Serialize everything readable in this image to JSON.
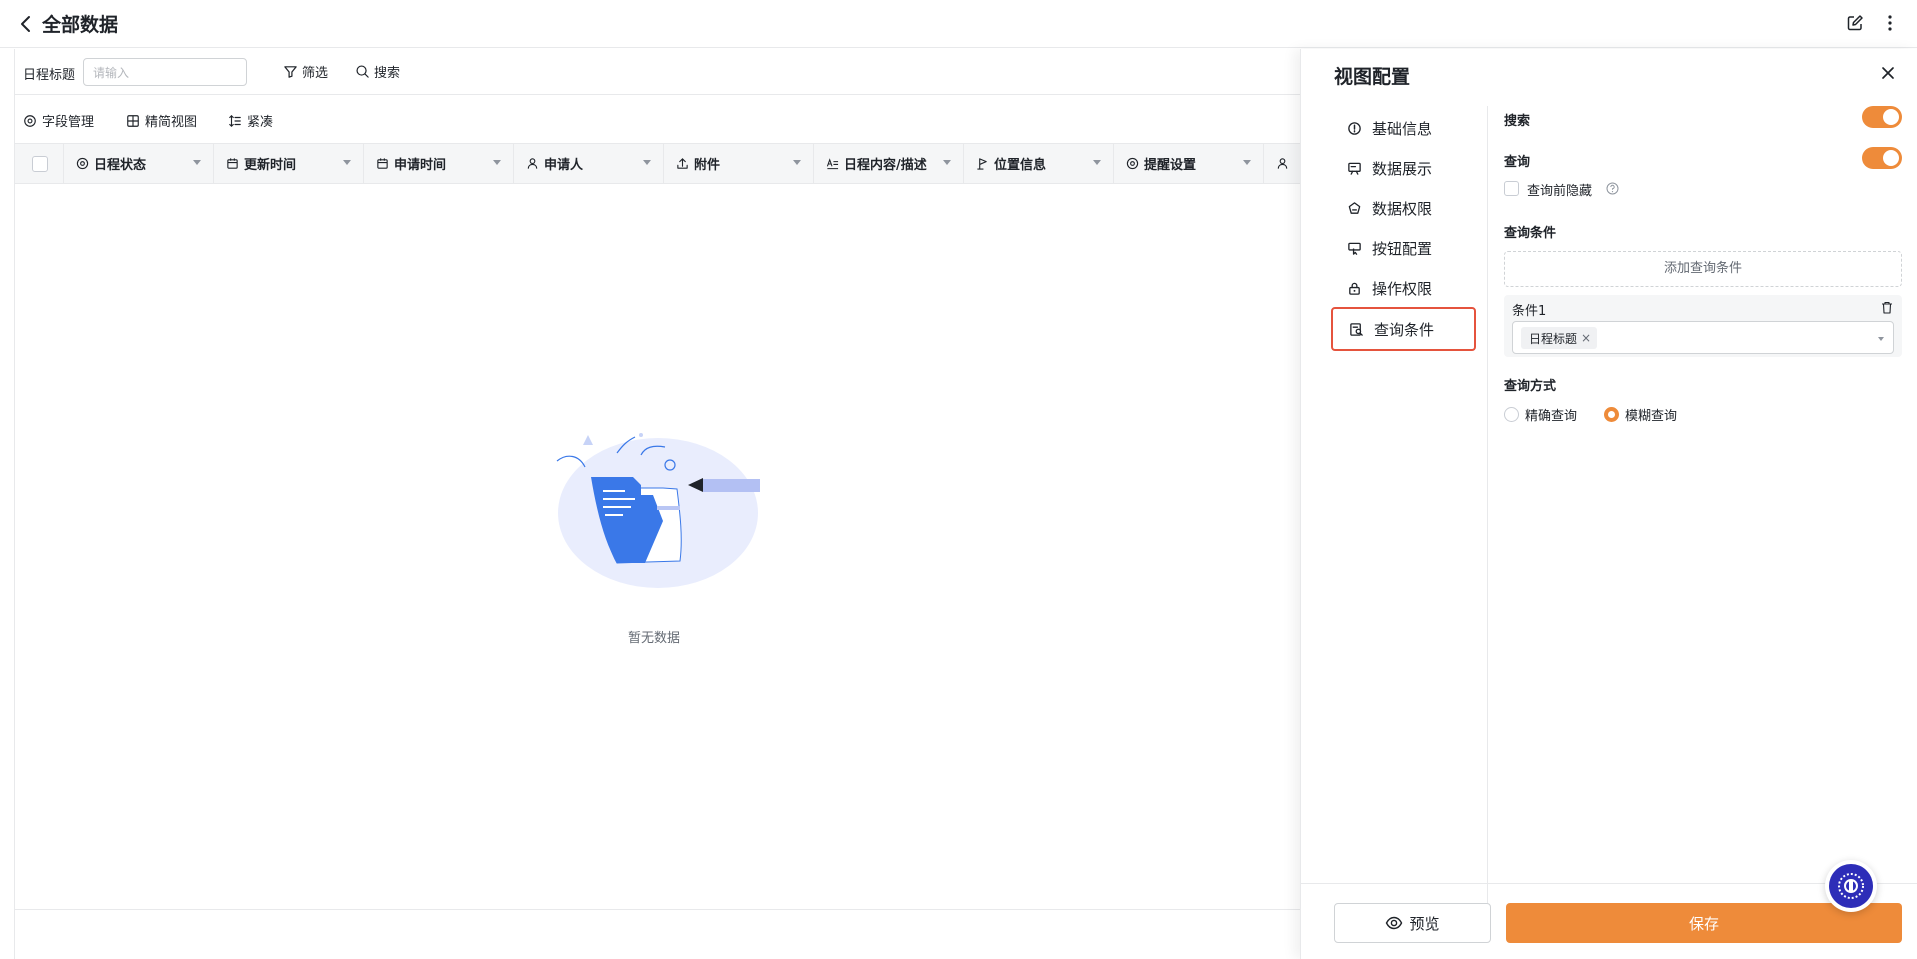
{
  "header": {
    "title": "全部数据"
  },
  "filter_bar": {
    "field_label": "日程标题",
    "input_placeholder": "请输入",
    "filter_label": "筛选",
    "search_label": "搜索"
  },
  "toolbar": {
    "field_manage": "字段管理",
    "compact_view": "精简视图",
    "density": "紧凑"
  },
  "table": {
    "columns": [
      {
        "label": "日程状态",
        "icon": "status-icon"
      },
      {
        "label": "更新时间",
        "icon": "calendar-icon"
      },
      {
        "label": "申请时间",
        "icon": "calendar-icon"
      },
      {
        "label": "申请人",
        "icon": "person-icon"
      },
      {
        "label": "附件",
        "icon": "upload-icon"
      },
      {
        "label": "日程内容/描述",
        "icon": "text-icon"
      },
      {
        "label": "位置信息",
        "icon": "location-icon"
      },
      {
        "label": "提醒设置",
        "icon": "status-icon"
      },
      {
        "label": "",
        "icon": "person-icon"
      }
    ],
    "empty_text": "暂无数据"
  },
  "panel": {
    "title": "视图配置",
    "nav": [
      {
        "label": "基础信息",
        "icon": "info-icon",
        "active": false
      },
      {
        "label": "数据展示",
        "icon": "display-icon",
        "active": false
      },
      {
        "label": "数据权限",
        "icon": "permission-icon",
        "active": false
      },
      {
        "label": "按钮配置",
        "icon": "button-config-icon",
        "active": false
      },
      {
        "label": "操作权限",
        "icon": "lock-icon",
        "active": false
      },
      {
        "label": "查询条件",
        "icon": "query-icon",
        "active": true
      }
    ],
    "search_label": "搜索",
    "search_enabled": true,
    "query_label": "查询",
    "query_enabled": true,
    "hide_before_query_label": "查询前隐藏",
    "hide_before_query_checked": false,
    "conditions_label": "查询条件",
    "add_condition_label": "添加查询条件",
    "conditions": [
      {
        "name": "条件1",
        "tags": [
          "日程标题"
        ]
      }
    ],
    "query_mode_label": "查询方式",
    "query_modes": [
      {
        "label": "精确查询",
        "selected": false
      },
      {
        "label": "模糊查询",
        "selected": true
      }
    ],
    "preview_label": "预览",
    "save_label": "保存"
  },
  "colors": {
    "accent": "#ee8b3a",
    "highlight_border": "#e5533d",
    "illustration_blue": "#3a78e8",
    "assistant": "#2d2db8"
  }
}
